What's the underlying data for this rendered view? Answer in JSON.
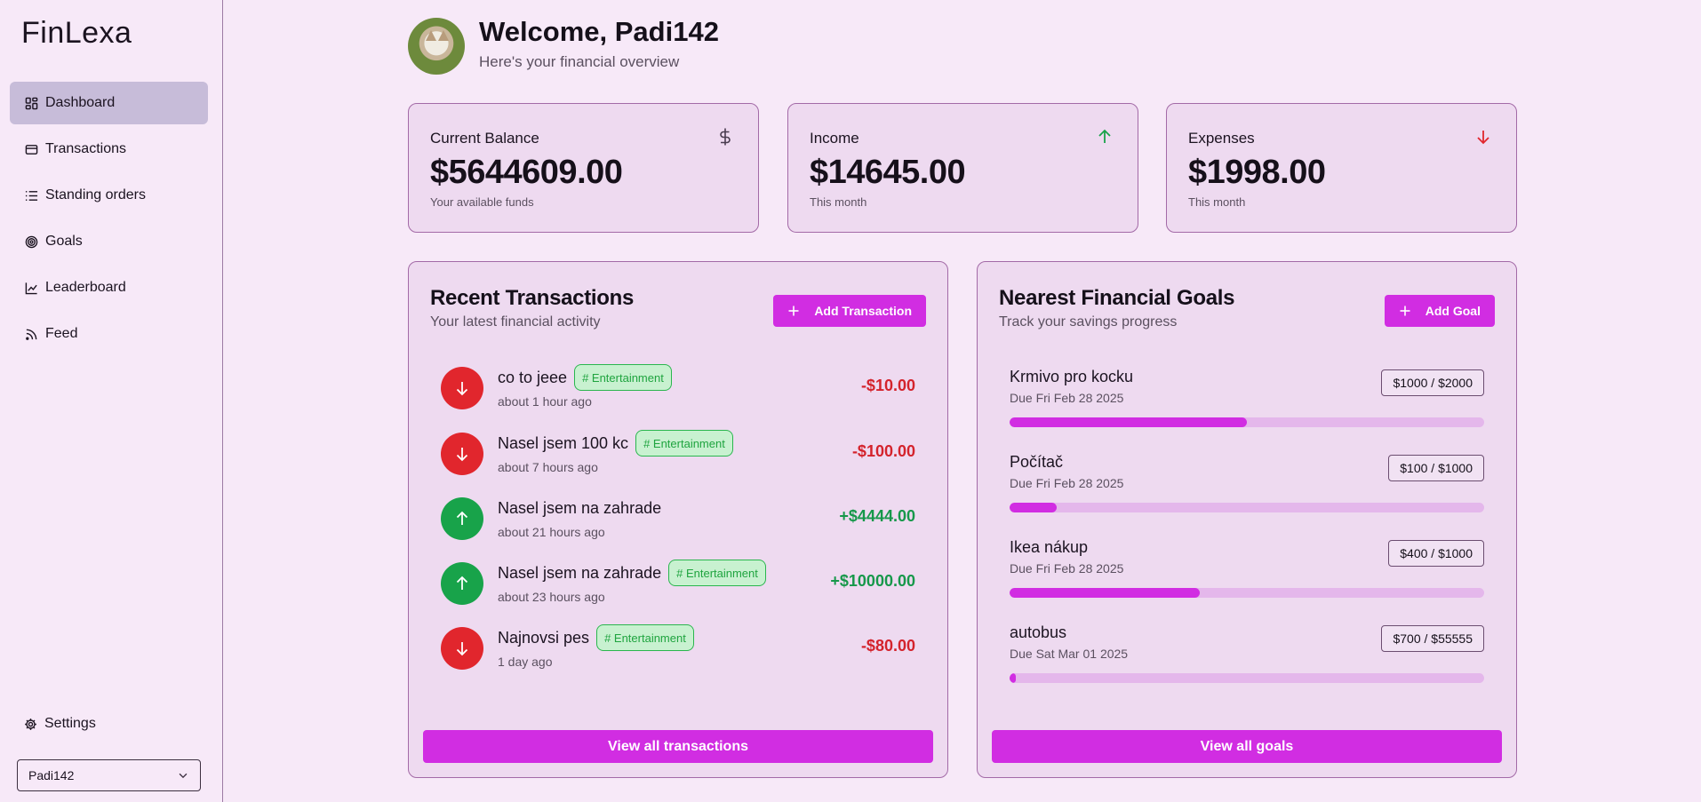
{
  "app": {
    "logo": "FinLexa"
  },
  "sidebar": {
    "items": [
      {
        "label": "Dashboard",
        "icon": "dashboard-icon",
        "active": true
      },
      {
        "label": "Transactions",
        "icon": "card-icon",
        "active": false
      },
      {
        "label": "Standing orders",
        "icon": "list-icon",
        "active": false
      },
      {
        "label": "Goals",
        "icon": "target-icon",
        "active": false
      },
      {
        "label": "Leaderboard",
        "icon": "chart-line-icon",
        "active": false
      },
      {
        "label": "Feed",
        "icon": "rss-icon",
        "active": false
      }
    ],
    "settings_label": "Settings",
    "user_select": "Padi142"
  },
  "header": {
    "welcome": "Welcome, Padi142",
    "subtitle": "Here's your financial overview"
  },
  "stats": {
    "balance": {
      "label": "Current Balance",
      "value": "$5644609.00",
      "note": "Your available funds",
      "icon": "dollar-icon"
    },
    "income": {
      "label": "Income",
      "value": "$14645.00",
      "note": "This month",
      "icon": "arrow-up-icon"
    },
    "expenses": {
      "label": "Expenses",
      "value": "$1998.00",
      "note": "This month",
      "icon": "arrow-down-icon"
    }
  },
  "transactions": {
    "title": "Recent Transactions",
    "subtitle": "Your latest financial activity",
    "add_label": "Add Transaction",
    "view_all_label": "View all transactions",
    "items": [
      {
        "name": "co to jeee",
        "tag": "# Entertainment",
        "time": "about 1 hour ago",
        "amount": "-$10.00",
        "direction": "down"
      },
      {
        "name": "Nasel jsem 100 kc",
        "tag": "# Entertainment",
        "time": "about 7 hours ago",
        "amount": "-$100.00",
        "direction": "down"
      },
      {
        "name": "Nasel jsem na zahrade",
        "tag": "",
        "time": "about 21 hours ago",
        "amount": "+$4444.00",
        "direction": "up"
      },
      {
        "name": "Nasel jsem na zahrade",
        "tag": "# Entertainment",
        "time": "about 23 hours ago",
        "amount": "+$10000.00",
        "direction": "up"
      },
      {
        "name": "Najnovsi pes",
        "tag": "# Entertainment",
        "time": "1 day ago",
        "amount": "-$80.00",
        "direction": "down"
      }
    ]
  },
  "goals": {
    "title": "Nearest Financial Goals",
    "subtitle": "Track your savings progress",
    "add_label": "Add Goal",
    "view_all_label": "View all goals",
    "items": [
      {
        "name": "Krmivo pro kocku",
        "due": "Due Fri Feb 28 2025",
        "badge": "$1000 / $2000",
        "progress": 0.5
      },
      {
        "name": "Počítač",
        "due": "Due Fri Feb 28 2025",
        "badge": "$100 / $1000",
        "progress": 0.1
      },
      {
        "name": "Ikea nákup",
        "due": "Due Fri Feb 28 2025",
        "badge": "$400 / $1000",
        "progress": 0.4
      },
      {
        "name": "autobus",
        "due": "Due Sat Mar 01 2025",
        "badge": "$700 / $55555",
        "progress": 0.0126
      }
    ]
  },
  "colors": {
    "accent": "#d12de2",
    "positive": "#16984a",
    "negative": "#d4232c",
    "background": "#f7e9f8",
    "card": "#eedaf0"
  }
}
